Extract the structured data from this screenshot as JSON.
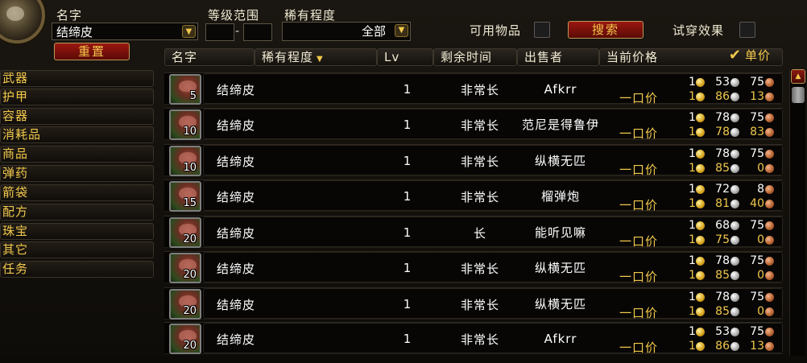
{
  "filters": {
    "name_label": "名字",
    "name_value": "结缔皮",
    "level_label": "等级范围",
    "level_dash": "-",
    "rarity_label": "稀有程度",
    "rarity_value": "全部",
    "usable_label": "可用物品",
    "tryon_label": "试穿效果",
    "search_label": "搜索",
    "reset_label": "重置"
  },
  "columns": {
    "name": "名字",
    "rarity": "稀有程度",
    "lv": "Lv",
    "time_left": "剩余时间",
    "seller": "出售者",
    "current_price": "当前价格",
    "unit_price": "单价"
  },
  "categories": [
    "武器",
    "护甲",
    "容器",
    "消耗品",
    "商品",
    "弹药",
    "箭袋",
    "配方",
    "珠宝",
    "其它",
    "任务"
  ],
  "rows": [
    {
      "stack": "5",
      "name": "结缔皮",
      "lv": "1",
      "time": "非常长",
      "seller": "Afkrr",
      "buyout": "一口价",
      "bid": {
        "g": "1",
        "s": "53",
        "c": "75"
      },
      "buy": {
        "g": "1",
        "s": "86",
        "c": "13"
      }
    },
    {
      "stack": "10",
      "name": "结缔皮",
      "lv": "1",
      "time": "非常长",
      "seller": "范尼是得鲁伊",
      "buyout": "一口价",
      "bid": {
        "g": "1",
        "s": "78",
        "c": "75"
      },
      "buy": {
        "g": "1",
        "s": "78",
        "c": "83"
      }
    },
    {
      "stack": "10",
      "name": "结缔皮",
      "lv": "1",
      "time": "非常长",
      "seller": "纵横无匹",
      "buyout": "一口价",
      "bid": {
        "g": "1",
        "s": "78",
        "c": "75"
      },
      "buy": {
        "g": "1",
        "s": "85",
        "c": "0"
      }
    },
    {
      "stack": "15",
      "name": "结缔皮",
      "lv": "1",
      "time": "非常长",
      "seller": "榴弹炮",
      "buyout": "一口价",
      "bid": {
        "g": "1",
        "s": "72",
        "c": "8"
      },
      "buy": {
        "g": "1",
        "s": "81",
        "c": "40"
      }
    },
    {
      "stack": "20",
      "name": "结缔皮",
      "lv": "1",
      "time": "长",
      "seller": "能听见嘛",
      "buyout": "一口价",
      "bid": {
        "g": "1",
        "s": "68",
        "c": "75"
      },
      "buy": {
        "g": "1",
        "s": "75",
        "c": "0"
      }
    },
    {
      "stack": "20",
      "name": "结缔皮",
      "lv": "1",
      "time": "非常长",
      "seller": "纵横无匹",
      "buyout": "一口价",
      "bid": {
        "g": "1",
        "s": "78",
        "c": "75"
      },
      "buy": {
        "g": "1",
        "s": "85",
        "c": "0"
      }
    },
    {
      "stack": "20",
      "name": "结缔皮",
      "lv": "1",
      "time": "非常长",
      "seller": "纵横无匹",
      "buyout": "一口价",
      "bid": {
        "g": "1",
        "s": "78",
        "c": "75"
      },
      "buy": {
        "g": "1",
        "s": "85",
        "c": "0"
      }
    },
    {
      "stack": "20",
      "name": "结缔皮",
      "lv": "1",
      "time": "非常长",
      "seller": "Afkrr",
      "buyout": "一口价",
      "bid": {
        "g": "1",
        "s": "53",
        "c": "75"
      },
      "buy": {
        "g": "1",
        "s": "86",
        "c": "13"
      }
    }
  ],
  "colors": {
    "gold_text": "#f2c94c",
    "red_button": "#9a1710",
    "background": "#0d0b08"
  },
  "icons": [
    "portrait-icon",
    "dropdown-arrow-icon",
    "sort-arrow-icon",
    "checkmark-icon",
    "item-leather-icon",
    "gold-coin-icon",
    "silver-coin-icon",
    "copper-coin-icon",
    "scroll-up-icon"
  ]
}
